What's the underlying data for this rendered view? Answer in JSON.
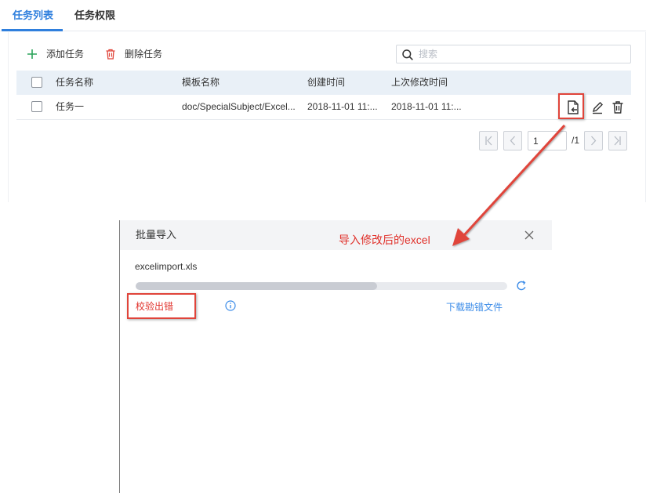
{
  "tabs": [
    {
      "label": "任务列表",
      "active": true
    },
    {
      "label": "任务权限",
      "active": false
    }
  ],
  "toolbar": {
    "add_label": "添加任务",
    "delete_label": "删除任务",
    "search_placeholder": "搜索",
    "add_icon": "plus-icon",
    "delete_icon": "trash-icon"
  },
  "table": {
    "headers": [
      "任务名称",
      "模板名称",
      "创建时间",
      "上次修改时间"
    ],
    "rows": [
      {
        "name": "任务一",
        "template": "doc/SpecialSubject/Excel...",
        "created": "2018-11-01 11:...",
        "modified": "2018-11-01 11:..."
      }
    ],
    "row_actions": [
      "import-excel-icon",
      "edit-icon",
      "trash-icon"
    ]
  },
  "pagination": {
    "current_page": "1",
    "total_text": "/1"
  },
  "dialog": {
    "title": "批量导入",
    "file_name": "excelimport.xls",
    "progress": 0.65,
    "status_text": "校验出错",
    "download_label": "下载勘错文件"
  },
  "annotation": {
    "text": "导入修改后的excel"
  },
  "colors": {
    "accent": "#2f7fdd",
    "error": "#e0302a",
    "link": "#3a8be8",
    "header_bg": "#e9f0f7",
    "add_green": "#2ba45a",
    "delete_red": "#e0443a"
  }
}
